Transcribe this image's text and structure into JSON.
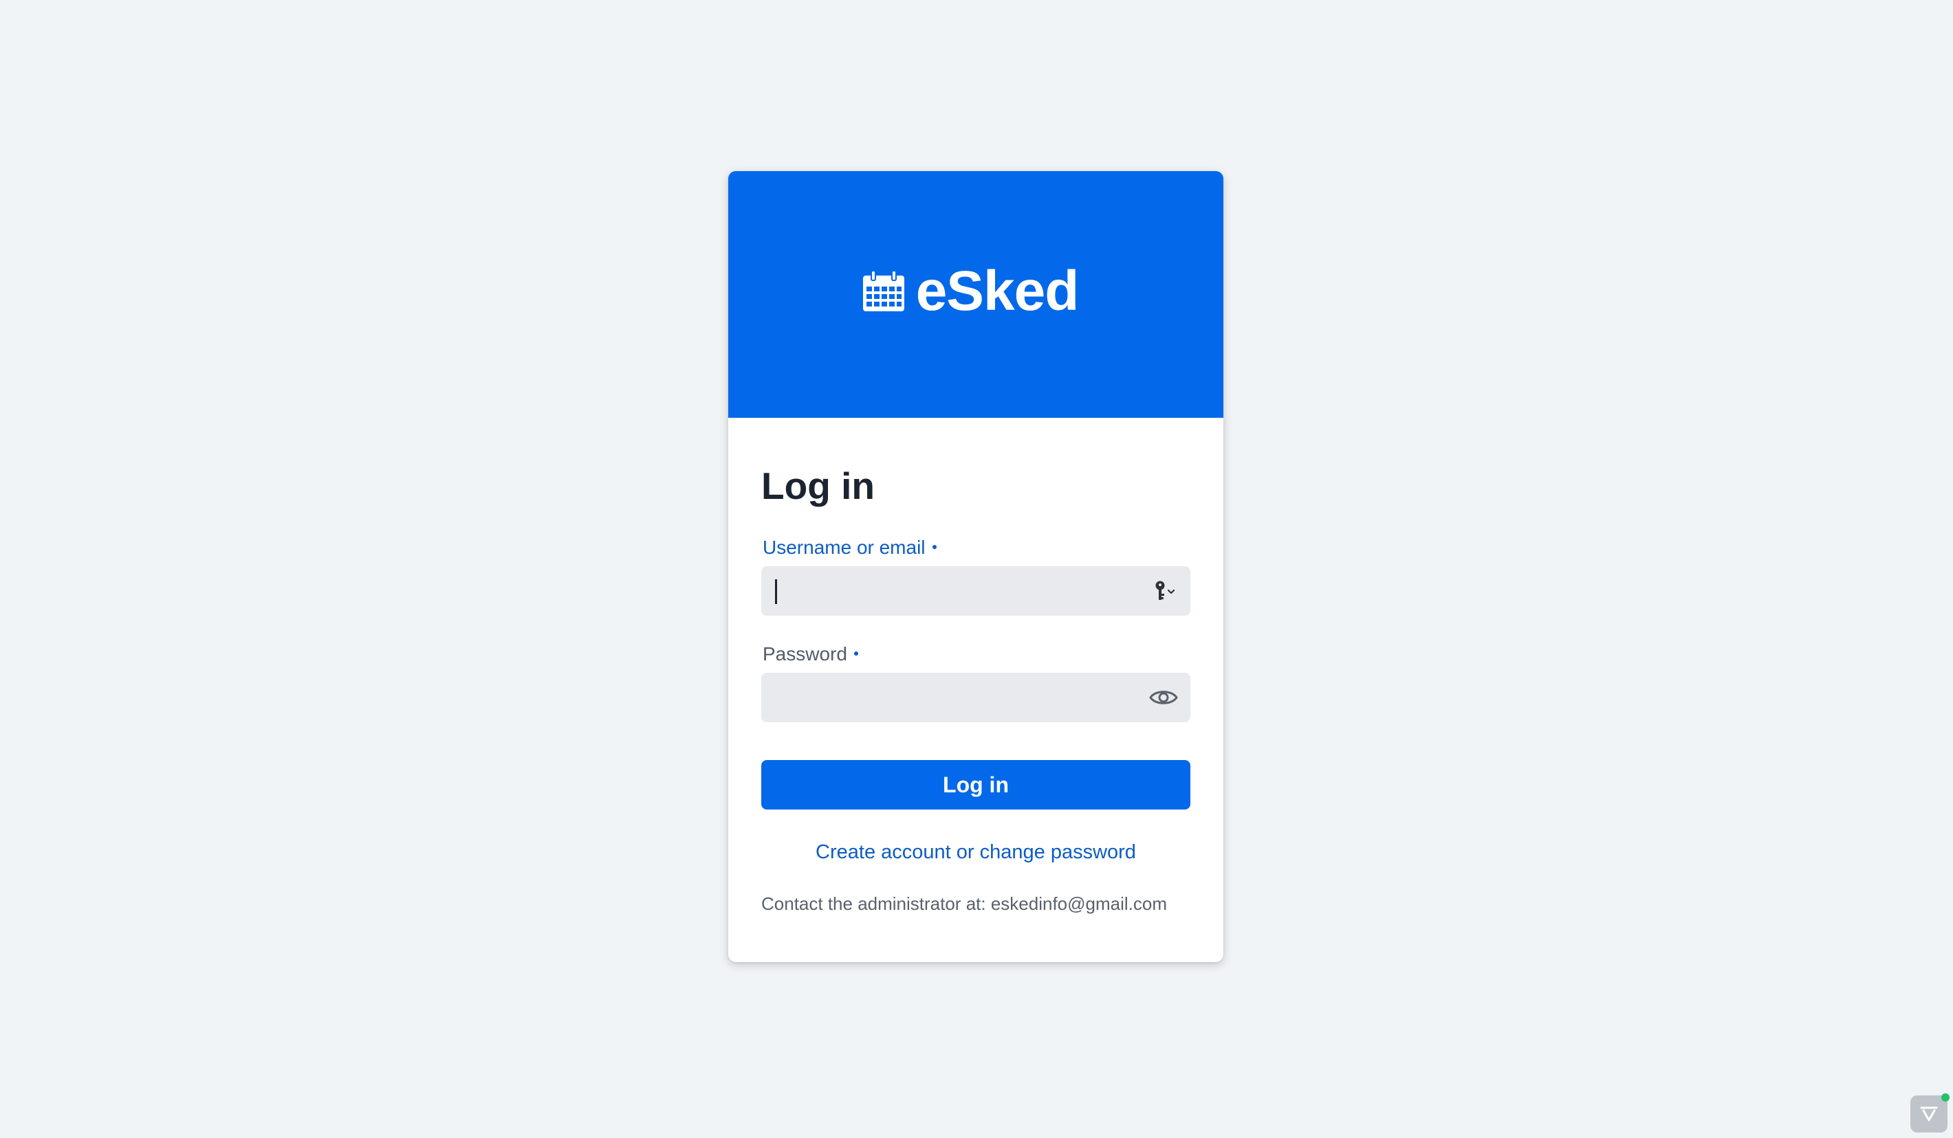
{
  "brand": {
    "name": "eSked",
    "icon": "calendar-icon",
    "color": "#0369ea"
  },
  "login": {
    "title": "Log in",
    "username_label": "Username or email",
    "username_value": "",
    "username_icon": "key-dropdown-icon",
    "password_label": "Password",
    "password_value": "",
    "password_icon": "eye-icon",
    "submit_label": "Log in",
    "create_link": "Create account or change password",
    "contact_text": "Contact the administrator at: eskedinfo@gmail.com"
  },
  "colors": {
    "background": "#f1f4f7",
    "accent": "#0369ea",
    "link": "#0c5cc4",
    "field_bg": "#e8eaed"
  },
  "widget": {
    "icon": "feedback-icon",
    "status_color": "#25c26a"
  }
}
